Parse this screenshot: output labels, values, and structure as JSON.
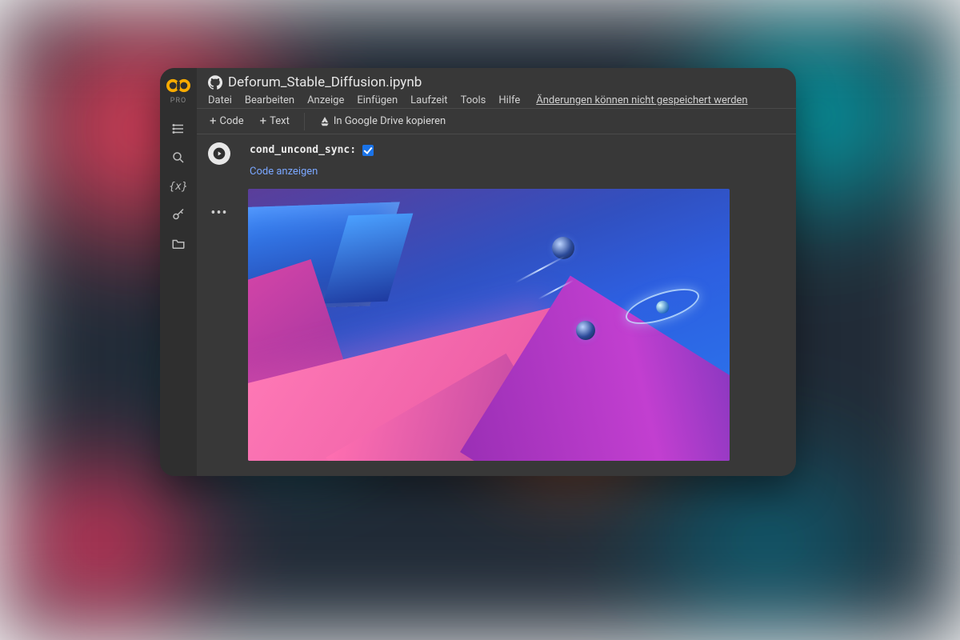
{
  "app": {
    "pro_label": "PRO"
  },
  "header": {
    "title": "Deforum_Stable_Diffusion.ipynb",
    "menu": [
      "Datei",
      "Bearbeiten",
      "Anzeige",
      "Einfügen",
      "Laufzeit",
      "Tools",
      "Hilfe"
    ],
    "save_warning": "Änderungen können nicht gespeichert werden"
  },
  "toolbar": {
    "code_label": "Code",
    "text_label": "Text",
    "drive_copy_label": "In Google Drive kopieren"
  },
  "cell": {
    "param_label": "cond_uncond_sync:",
    "param_checked": true,
    "show_code_label": "Code anzeigen"
  }
}
